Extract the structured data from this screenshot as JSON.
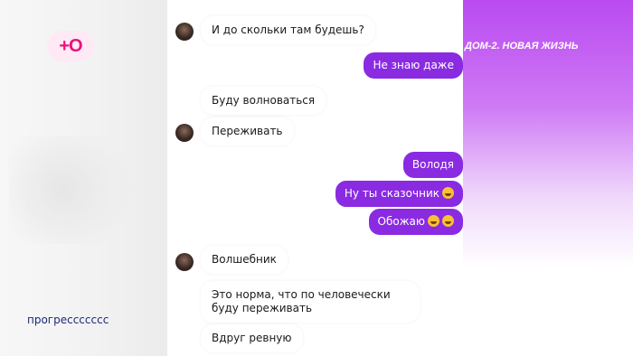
{
  "channel": {
    "logo_text": "+O",
    "show_title": "ДОМ-2. НОВАЯ ЖИЗНЬ",
    "subtitle": "прогрессссссс"
  },
  "chat": {
    "messages": [
      {
        "side": "in",
        "text": "И до скольки там будешь?"
      },
      {
        "side": "out",
        "text": "Не знаю даже"
      },
      {
        "side": "in",
        "text": "Буду волноваться"
      },
      {
        "side": "in",
        "text": "Переживать"
      },
      {
        "side": "out",
        "text": "Володя"
      },
      {
        "side": "out",
        "text": "Ну ты сказочник",
        "emoji": [
          "face-with-tears-of-joy"
        ]
      },
      {
        "side": "out",
        "text": "Обожаю",
        "emoji": [
          "face-with-tears-of-joy",
          "face-with-tears-of-joy"
        ]
      },
      {
        "side": "in",
        "text": "Волшебник"
      },
      {
        "side": "in",
        "text": "Это норма, что по человечески буду переживать"
      },
      {
        "side": "in",
        "text": "Вдруг ревную"
      }
    ]
  },
  "colors": {
    "outgoing_bubble": "#8a2be2",
    "brand_pink": "#e8127a",
    "subtitle_text": "#1b2a7a"
  }
}
